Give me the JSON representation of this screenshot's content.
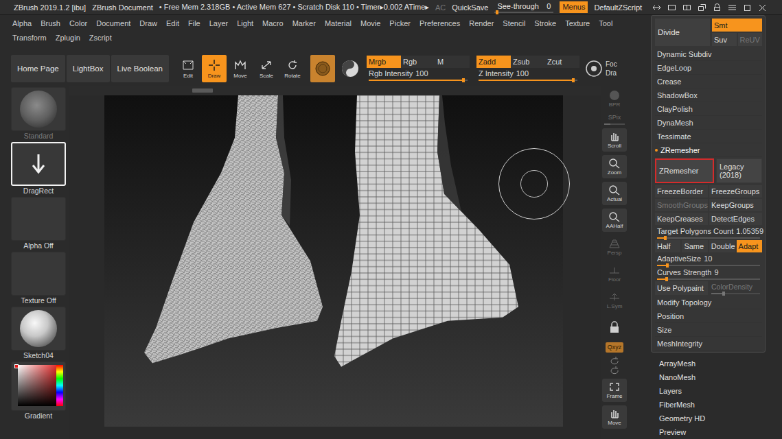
{
  "title_bar": {
    "app": "ZBrush 2019.1.2 [ibu]",
    "document": "ZBrush Document",
    "stats": "• Free Mem 2.318GB • Active Mem 627 • Scratch Disk 110 • Timer▸0.002 ATime▸",
    "ac": {
      "label": "AC",
      "disabled": true
    },
    "quicksave": "QuickSave",
    "see_through": {
      "label": "See-through",
      "value": "0",
      "level": 0
    },
    "menus": {
      "label": "Menus",
      "selected": true
    },
    "script": "DefaultZScript"
  },
  "menu_bar": {
    "rows": [
      [
        "Alpha",
        "Brush",
        "Color",
        "Document",
        "Draw",
        "Edit",
        "File",
        "Layer",
        "Light",
        "Macro",
        "Marker",
        "Material",
        "Movie",
        "Picker",
        "Preferences",
        "Render",
        "Stencil",
        "Stroke",
        "Texture",
        "Tool"
      ],
      [
        "Transform",
        "Zplugin",
        "Zscript"
      ]
    ]
  },
  "toolbar": {
    "nav": [
      "Home Page",
      "LightBox",
      "Live Boolean"
    ],
    "modes": [
      {
        "label": "Edit",
        "selected": false
      },
      {
        "label": "Draw",
        "selected": true
      },
      {
        "label": "Move",
        "selected": false
      },
      {
        "label": "Scale",
        "selected": false
      },
      {
        "label": "Rotate",
        "selected": false
      }
    ],
    "material": {
      "selected": true
    },
    "channels": [
      {
        "label": "Mrgb",
        "selected": true
      },
      {
        "label": "Rgb",
        "selected": false
      },
      {
        "label": "M",
        "selected": false
      }
    ],
    "z_modes": [
      {
        "label": "Zadd",
        "selected": true
      },
      {
        "label": "Zsub",
        "selected": false
      },
      {
        "label": "Zcut",
        "selected": false
      }
    ],
    "sliders": [
      {
        "label": "Rgb Intensity",
        "value": "100",
        "level": 0.96
      },
      {
        "label": "Z Intensity",
        "value": "100",
        "level": 0.96
      }
    ],
    "focal": [
      "Foc",
      "Dra"
    ]
  },
  "left_shelf": [
    {
      "kind": "brush",
      "label": "Standard",
      "disabled": true,
      "selected": false
    },
    {
      "kind": "stroke",
      "label": "DragRect",
      "disabled": false,
      "selected": true
    },
    {
      "kind": "alpha",
      "label": "Alpha Off",
      "disabled": false,
      "selected": false
    },
    {
      "kind": "texture",
      "label": "Texture Off",
      "disabled": false,
      "selected": false
    },
    {
      "kind": "material",
      "label": "Sketch04",
      "disabled": false,
      "selected": false
    },
    {
      "kind": "color",
      "label": "Gradient",
      "disabled": false,
      "selected": false
    }
  ],
  "viewport_shelf": [
    {
      "kind": "button",
      "label": "BPR",
      "disabled": true,
      "selected": false
    },
    {
      "kind": "slider",
      "label": "SPix",
      "disabled": true,
      "level": 0.3
    },
    {
      "kind": "button",
      "label": "Scroll",
      "disabled": false,
      "selected": false
    },
    {
      "kind": "button",
      "label": "Zoom",
      "disabled": false,
      "selected": false
    },
    {
      "kind": "button",
      "label": "Actual",
      "disabled": false,
      "selected": false
    },
    {
      "kind": "button",
      "label": "AAHalf",
      "disabled": false,
      "selected": false
    },
    {
      "kind": "button",
      "label": "Persp",
      "disabled": true,
      "selected": false
    },
    {
      "kind": "button",
      "label": "Floor",
      "disabled": true,
      "selected": false
    },
    {
      "kind": "button",
      "label": "L.Sym",
      "disabled": true,
      "selected": false
    },
    {
      "kind": "lock",
      "selected": false
    },
    {
      "kind": "chip",
      "label": "Qxyz",
      "selected": true
    },
    {
      "kind": "rotate"
    },
    {
      "kind": "button",
      "label": "Frame",
      "disabled": false,
      "selected": false
    },
    {
      "kind": "button",
      "label": "Move",
      "disabled": false,
      "selected": false
    }
  ],
  "tool_panel": {
    "divide": {
      "label": "Divide",
      "options": [
        {
          "label": "Smt",
          "selected": true,
          "disabled": false
        },
        {
          "label": "Suv",
          "selected": false,
          "disabled": false
        },
        {
          "label": "ReUV",
          "selected": false,
          "disabled": true
        }
      ]
    },
    "subpalettes_before": [
      {
        "label": "Dynamic Subdiv",
        "expanded": false
      },
      {
        "label": "EdgeLoop",
        "expanded": false
      },
      {
        "label": "Crease",
        "expanded": false
      },
      {
        "label": "ShadowBox",
        "expanded": false
      },
      {
        "label": "ClayPolish",
        "expanded": false
      },
      {
        "label": "DynaMesh",
        "expanded": false
      },
      {
        "label": "Tessimate",
        "expanded": false
      }
    ],
    "zremesher": {
      "label": "ZRemesher",
      "expanded": true,
      "actions": [
        {
          "label": "ZRemesher",
          "highlighted": true
        },
        {
          "label": "Legacy (2018)",
          "highlighted": false
        }
      ],
      "toggles": [
        {
          "label": "FreezeBorder",
          "selected": false,
          "disabled": false
        },
        {
          "label": "FreezeGroups",
          "selected": false,
          "disabled": false
        },
        {
          "label": "SmoothGroups",
          "selected": false,
          "disabled": true
        },
        {
          "label": "KeepGroups",
          "selected": false,
          "disabled": false
        },
        {
          "label": "KeepCreases",
          "selected": false,
          "disabled": false
        },
        {
          "label": "DetectEdges",
          "selected": false,
          "disabled": false
        }
      ],
      "target": {
        "label": "Target Polygons Count",
        "value": "1.05359",
        "level": 0.08
      },
      "modes": [
        {
          "label": "Half",
          "selected": false
        },
        {
          "label": "Same",
          "selected": false
        },
        {
          "label": "Double",
          "selected": false
        },
        {
          "label": "Adapt",
          "selected": true
        }
      ],
      "sliders": [
        {
          "label": "AdaptiveSize",
          "value": "10",
          "level": 0.1
        },
        {
          "label": "Curves Strength",
          "value": "9",
          "level": 0.09
        }
      ],
      "polypaint": {
        "label": "Use Polypaint",
        "selected": false,
        "disabled": false
      },
      "color_density": {
        "label": "ColorDensity",
        "disabled": true,
        "level": 0.25
      }
    },
    "subpalettes_after": [
      {
        "label": "Modify Topology",
        "expanded": false
      },
      {
        "label": "Position",
        "expanded": false
      },
      {
        "label": "Size",
        "expanded": false
      },
      {
        "label": "MeshIntegrity",
        "expanded": false
      }
    ]
  },
  "palettes": [
    "ArrayMesh",
    "NanoMesh",
    "Layers",
    "FiberMesh",
    "Geometry HD",
    "Preview"
  ]
}
